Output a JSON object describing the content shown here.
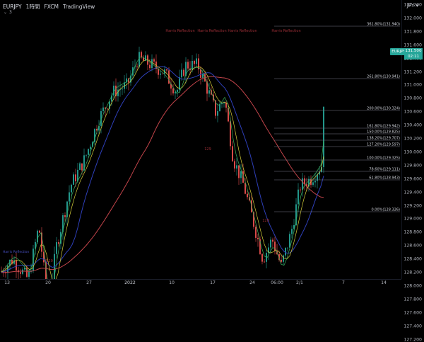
{
  "header": {
    "symbol": "EURJPY",
    "interval": "1時間",
    "exchange": "FXCM",
    "source": "TradingView",
    "indicator_count": "3",
    "currency": "JPY"
  },
  "price_axis": {
    "ticks": [
      "132.200",
      "132.000",
      "131.800",
      "131.600",
      "131.400",
      "131.200",
      "131.000",
      "130.800",
      "130.600",
      "130.400",
      "130.200",
      "130.000",
      "129.800",
      "129.600",
      "129.400",
      "129.200",
      "129.000",
      "128.800",
      "128.600",
      "128.400",
      "128.200",
      "128.000",
      "127.800",
      "127.600",
      "127.400",
      "127.200"
    ],
    "current_price": "131.500",
    "countdown": "02:11",
    "current_symbol": "EURJPY"
  },
  "time_axis": {
    "ticks": [
      "13",
      "20",
      "27",
      "2022",
      "10",
      "17",
      "24",
      "06:00",
      "2/1",
      "7",
      "14"
    ]
  },
  "fib_levels": [
    {
      "label": "361.80%(131.940)"
    },
    {
      "label": "261.80%(130.941)"
    },
    {
      "label": "200.00%(130.324)"
    },
    {
      "label": "161.80%(129.942)"
    },
    {
      "label": "150.00%(129.825)"
    },
    {
      "label": "138.20%(129.707)"
    },
    {
      "label": "127.20%(129.597)"
    },
    {
      "label": "100.00%(129.325)"
    },
    {
      "label": "78.60%(129.111)"
    },
    {
      "label": "61.80%(128.943)"
    },
    {
      "label": "0.00%(128.326)"
    }
  ],
  "annotations": {
    "pattern_labels": [
      "Harris Reflection",
      "Harris Reflection",
      "Harris Reflection",
      "Harris Reflection"
    ],
    "low_label": "129",
    "mid_label": "129",
    "right_label": "128",
    "left_label": "Harris Reflection"
  },
  "colors": {
    "background": "#000000",
    "bull": "#26a69a",
    "bear": "#ef5350",
    "ma_red": "#c2444a",
    "ma_blue": "#2e3fb8",
    "ma_yellow": "#d6cf3a",
    "ma_green": "#3cae5a",
    "fib_line": "#787b86",
    "annotation": "#9c2e36"
  }
}
